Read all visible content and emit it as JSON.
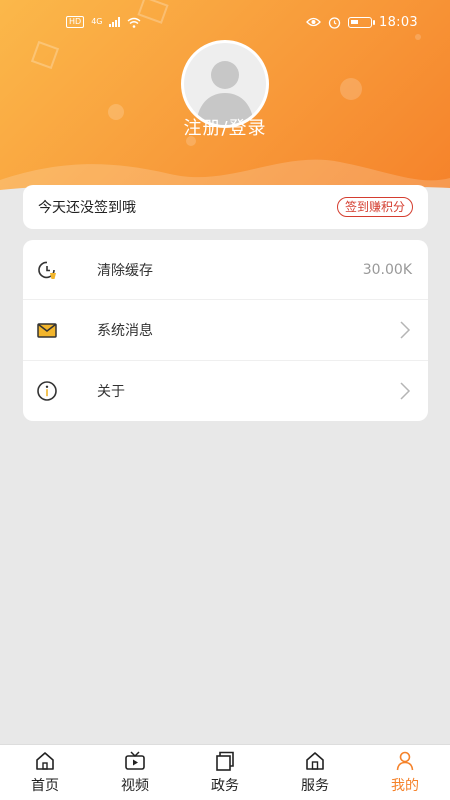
{
  "status_bar": {
    "time": "18:03",
    "network": "4G",
    "hd": "HD"
  },
  "profile": {
    "login_label": "注册/登录"
  },
  "signin": {
    "text": "今天还没签到哦",
    "button_label": "签到赚积分"
  },
  "menu": {
    "items": [
      {
        "label": "清除缓存",
        "value": "30.00K",
        "icon": "clock-clear-icon"
      },
      {
        "label": "系统消息",
        "value": "",
        "icon": "envelope-icon"
      },
      {
        "label": "关于",
        "value": "",
        "icon": "info-icon"
      }
    ]
  },
  "tabbar": {
    "tabs": [
      {
        "label": "首页",
        "icon": "home-icon"
      },
      {
        "label": "视频",
        "icon": "video-icon"
      },
      {
        "label": "政务",
        "icon": "government-icon"
      },
      {
        "label": "服务",
        "icon": "service-icon"
      },
      {
        "label": "我的",
        "icon": "user-icon"
      }
    ],
    "active": "我的"
  },
  "colors": {
    "accent": "#f5822a",
    "header_start": "#fbb84a",
    "signin_red": "#d43d2f"
  }
}
